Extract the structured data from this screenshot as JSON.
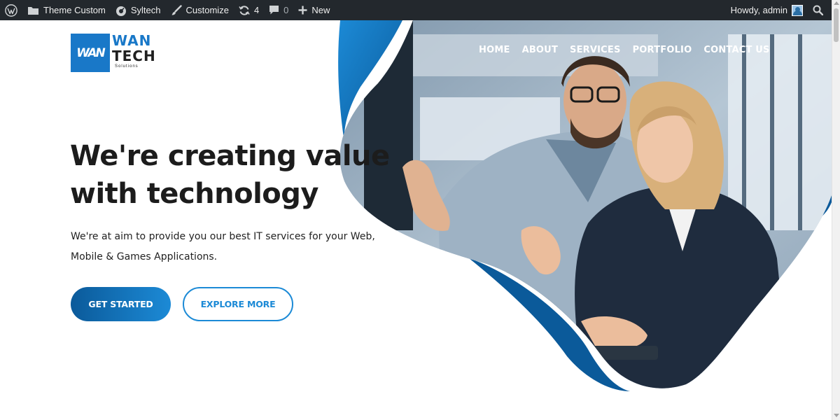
{
  "adminbar": {
    "site_name": "Theme Custom",
    "theme_name": "Syltech",
    "customize": "Customize",
    "updates_count": "4",
    "comments_count": "0",
    "new_label": "New",
    "howdy": "Howdy, admin"
  },
  "logo": {
    "mark_text": "WAN",
    "line1": "WAN",
    "line2": "TECH",
    "tagline": "Solutions",
    "brand_color": "#1978c8"
  },
  "nav": {
    "items": [
      "HOME",
      "ABOUT",
      "SERVICES",
      "PORTFOLIO",
      "CONTACT US"
    ]
  },
  "hero": {
    "title_line1": "We're creating value",
    "title_line2": "with technology",
    "subtitle_line1": "We're at aim to provide you our best IT services for your Web,",
    "subtitle_line2": "Mobile & Games Applications.",
    "primary_button": "GET STARTED",
    "secondary_button": "EXPLORE MORE",
    "accent_color": "#1c8ad6"
  }
}
